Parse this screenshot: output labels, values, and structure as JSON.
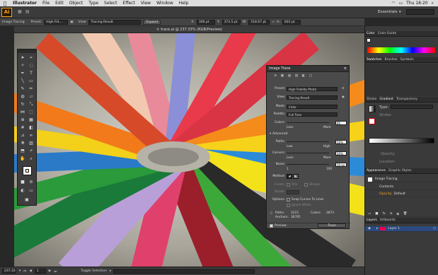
{
  "menubar": {
    "apple": "",
    "app": "Illustrator",
    "items": [
      "File",
      "Edit",
      "Object",
      "Type",
      "Select",
      "Effect",
      "View",
      "Window",
      "Help"
    ],
    "clock": "Thu 18:20",
    "workspace": "Essentials"
  },
  "logo": "Ai",
  "control": {
    "label": "Image Tracing",
    "preset_label": "Preset:",
    "preset": "High Fid...",
    "view_label": "View:",
    "view": "Tracing Result",
    "expand": "Expand",
    "x_label": "X:",
    "x": "306 pt",
    "y_label": "Y:",
    "y": "373.5 pt",
    "w_label": "W:",
    "w": "518.67 pt",
    "h_label": "H:",
    "h": "603 pt"
  },
  "doc": {
    "close": "×",
    "title": "trace.ai @ 237.33% (RGB/Preview)"
  },
  "status": {
    "zoom": "237.33",
    "page": "1",
    "tool": "Toggle Selection"
  },
  "imagetrace": {
    "title": "Image Trace",
    "preset_label": "Preset:",
    "preset": "High Fidelity Photo",
    "view_label": "View:",
    "view": "Tracing Result",
    "mode_label": "Mode:",
    "mode": "Color",
    "palette_label": "Palette:",
    "palette": "Full Tone",
    "colors_label": "Colors:",
    "colors": "85",
    "less": "Less",
    "more": "More",
    "advanced": "Advanced",
    "paths_label": "Paths:",
    "paths": "50%",
    "low": "Low",
    "high": "High",
    "corners_label": "Corners:",
    "corners": "50%",
    "noise_label": "Noise:",
    "noise": "10 px",
    "noise_min": "1",
    "noise_max": "100",
    "method_label": "Method:",
    "create_label": "Create:",
    "fills": "Fills",
    "strokes": "Strokes",
    "stroke_label": "Stroke:",
    "options_label": "Options:",
    "snap": "Snap Curves To Lines",
    "ignore": "Ignore White",
    "paths_stat_label": "Paths:",
    "paths_stat": "3215",
    "colors_stat_label": "Colors:",
    "colors_stat": "2873",
    "anchors_label": "Anchors:",
    "anchors": "36765",
    "preview": "Preview",
    "trace": "Trace"
  },
  "panels": {
    "color_tabs": [
      "Color",
      "Color Guide"
    ],
    "swatch_tabs": [
      "Swatches",
      "Brushes",
      "Symbols"
    ],
    "stroke_tabs": [
      "Stroke",
      "Gradient",
      "Transparency"
    ],
    "type_label": "Type:",
    "stroke_label": "Stroke:",
    "opacity_label": "Opacity:",
    "location_label": "Location:",
    "appearance_tabs": [
      "Appearance",
      "Graphic Styles"
    ],
    "appearance_title": "Image Tracing",
    "contents": "Contents",
    "opacity": "Opacity:",
    "opacity_val": "Default",
    "layers_tabs": [
      "Layers",
      "Artboards"
    ],
    "layer1": "Layer 1"
  },
  "colors": {
    "accent": "#f7a21b",
    "panel": "#3a3a3a",
    "panel_dark": "#2e2e2e",
    "selected_layer": "#2b4a80"
  }
}
